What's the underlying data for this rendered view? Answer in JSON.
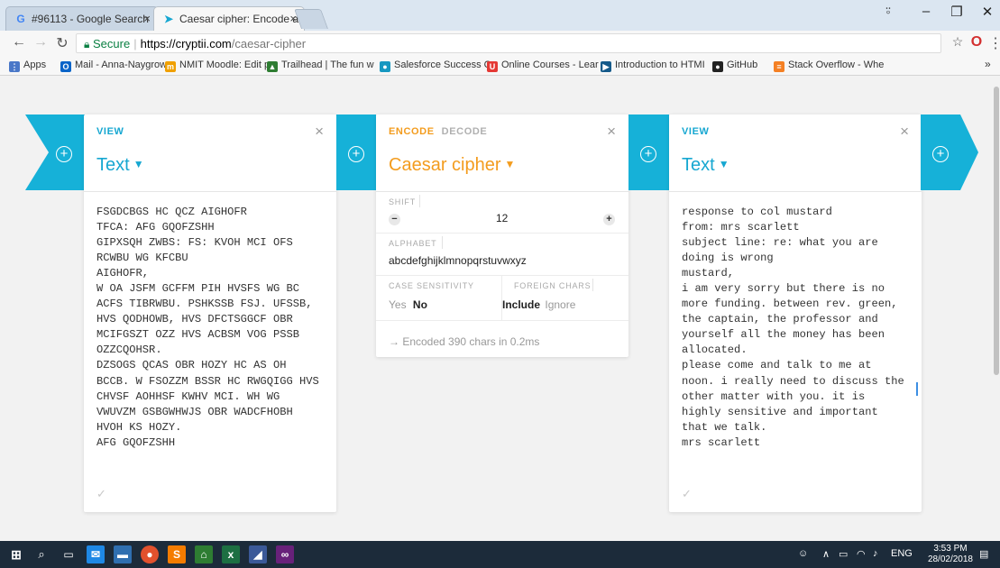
{
  "browser": {
    "tabs": [
      {
        "label": "#96113 - Google Search",
        "icon": "google-icon",
        "close": "×"
      },
      {
        "label": "Caesar cipher: Encode an",
        "icon": "cryptii-icon",
        "close": "×"
      }
    ],
    "address": {
      "secure_label": "Secure",
      "host": "https://cryptii.com",
      "path": "/caesar-cipher"
    },
    "bookmarks": [
      {
        "label": "Apps",
        "color": "#4a78c8",
        "glyph": "⋮⋮"
      },
      {
        "label": "Mail - Anna-Naygrow",
        "color": "#0a64c8",
        "glyph": "O"
      },
      {
        "label": "NMIT Moodle: Edit p",
        "color": "#f0a000",
        "glyph": "m"
      },
      {
        "label": "Trailhead | The fun w",
        "color": "#2e7d32",
        "glyph": "▲"
      },
      {
        "label": "Salesforce Success C",
        "color": "#1798c1",
        "glyph": "●"
      },
      {
        "label": "Online Courses - Lear",
        "color": "#e53935",
        "glyph": "U"
      },
      {
        "label": "Introduction to HTMI",
        "color": "#155a8a",
        "glyph": "▶"
      },
      {
        "label": "GitHub",
        "color": "#222222",
        "glyph": "●"
      },
      {
        "label": "Stack Overflow - Whe",
        "color": "#f48024",
        "glyph": "≡"
      }
    ],
    "more_bookmarks": "»"
  },
  "cards": {
    "left": {
      "label": "VIEW",
      "title": "Text",
      "close": "×",
      "text": "FSGDCBGS HC QCZ AIGHOFR\nTFCA: AFG GQOFZSHH\nGIPXSQH ZWBS: FS: KVOH MCI OFS\nRCWBU WG KFCBU\nAIGHOFR,\nW OA JSFM GCFFM PIH HVSFS WG BC\nACFS TIBRWBU. PSHKSSB FSJ. UFSSB,\nHVS QODHOWB, HVS DFCTSGGCF OBR\nMCIFGSZT OZZ HVS ACBSM VOG PSSB\nOZZCQOHSR.\nDZSOGS QCAS OBR HOZY HC AS OH\nBCCB. W FSOZZM BSSR HC RWGQIGG HVS\nCHVSF AOHHSF KWHV MCI. WH WG\nVWUVZM GSBGWHWJS OBR WADCFHOBH\nHVOH KS HOZY.\nAFG GQOFZSHH"
    },
    "middle": {
      "label_active": "ENCODE",
      "label_inactive": "DECODE",
      "title": "Caesar cipher",
      "close": "×",
      "shift": {
        "label": "SHIFT",
        "value": "12",
        "minus": "−",
        "plus": "+"
      },
      "alphabet": {
        "label": "ALPHABET",
        "value": "abcdefghijklmnopqrstuvwxyz"
      },
      "case_sensitivity": {
        "label": "CASE SENSITIVITY",
        "yes": "Yes",
        "no": "No"
      },
      "foreign_chars": {
        "label": "FOREIGN CHARS",
        "include": "Include",
        "ignore": "Ignore"
      },
      "status": "→  Encoded 390 chars in 0.2ms"
    },
    "right": {
      "label": "VIEW",
      "title": "Text",
      "close": "×",
      "text": "response to col mustard\nfrom: mrs scarlett\nsubject line: re: what you are\ndoing is wrong\nmustard,\ni am very sorry but there is no\nmore funding. between rev. green,\nthe captain, the professor and\nyourself all the money has been\nallocated.\nplease come and talk to me at\nnoon. i really need to discuss the\nother matter with you. it is\nhighly sensitive and important\nthat we talk.\nmrs scarlett"
    }
  },
  "taskbar": {
    "language": "ENG",
    "time": "3:53 PM",
    "date": "28/02/2018"
  },
  "colors": {
    "accent_blue": "#16b1d8",
    "accent_orange": "#f39c1e"
  }
}
